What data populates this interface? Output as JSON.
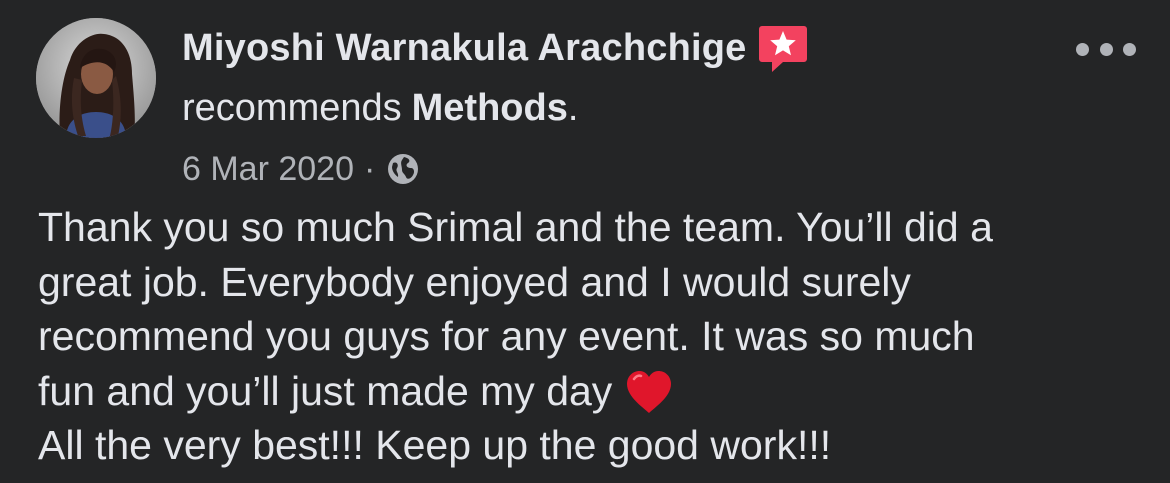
{
  "post": {
    "author_name": "Miyoshi Warnakula Arachchige",
    "recommend_verb": "recommends",
    "recommended_page": "Methods",
    "recommend_period": ".",
    "date": "6 Mar 2020",
    "date_separator": "·",
    "privacy_icon": "globe-icon",
    "badge_icon": "recommendation-star-icon",
    "menu_icon": "more-options-icon",
    "body_lines": [
      "Thank you so much Srimal and the team. You’ll did a",
      "great job. Everybody enjoyed and I would surely",
      "recommend you guys for any event. It was so much",
      "fun and you’ll just made my day",
      "All the very best!!! Keep up the good work!!!"
    ],
    "body_emoji": "red-heart-icon"
  },
  "colors": {
    "background": "#242526",
    "primary_text": "#e4e6eb",
    "secondary_text": "#b0b3b8",
    "badge": "#f3425f",
    "heart": "#e0162b"
  }
}
